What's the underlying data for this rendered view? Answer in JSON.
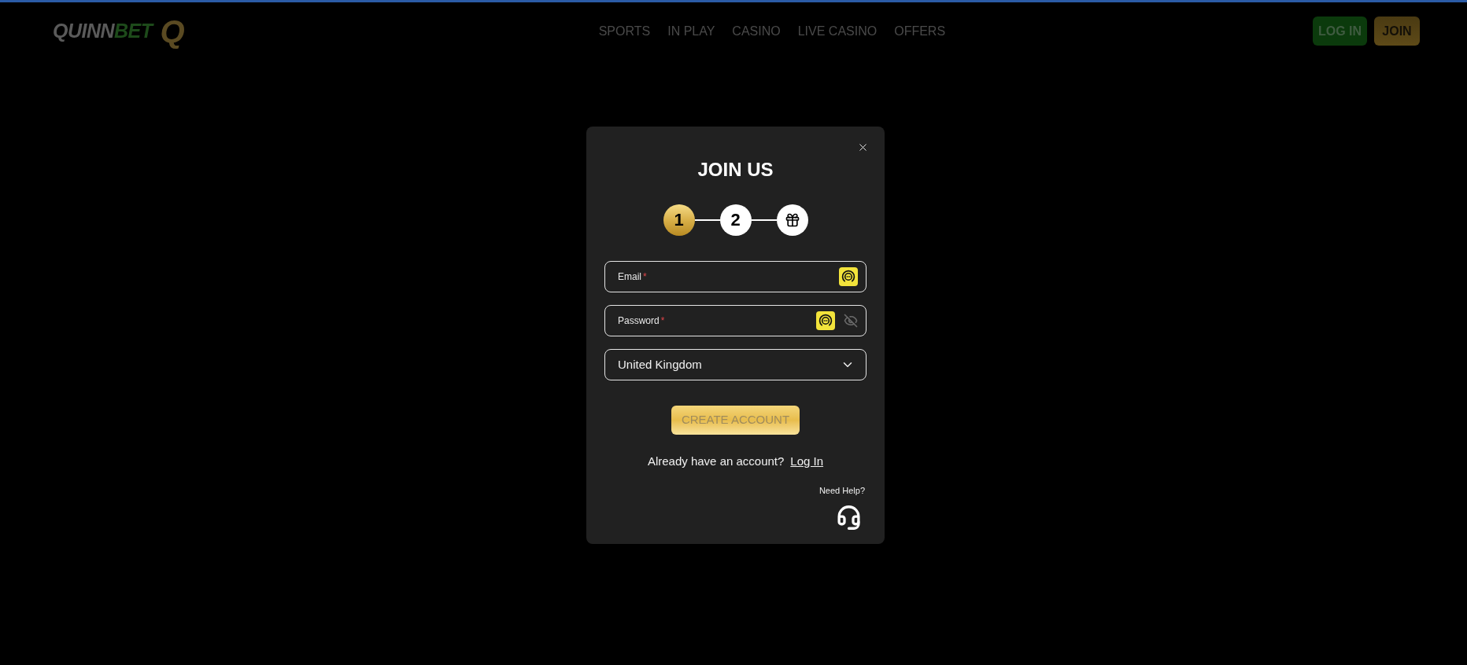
{
  "header": {
    "logo": {
      "name_part_1": "QUINN",
      "name_part_2": "BET",
      "mark": "Q"
    },
    "nav": [
      {
        "label": "SPORTS"
      },
      {
        "label": "IN PLAY"
      },
      {
        "label": "CASINO"
      },
      {
        "label": "LIVE CASINO"
      },
      {
        "label": "OFFERS"
      }
    ],
    "buttons": [
      {
        "kind": "login",
        "label": "LOG IN"
      },
      {
        "kind": "join",
        "label": "JOIN"
      }
    ]
  },
  "modal": {
    "title": "JOIN US",
    "steps": [
      {
        "kind": "number",
        "label": "1",
        "selected": true
      },
      {
        "kind": "number",
        "label": "2",
        "selected": false
      },
      {
        "kind": "gift",
        "selected": false
      }
    ],
    "fields": [
      {
        "kind": "email",
        "label": "Email",
        "required_mark": "*"
      },
      {
        "kind": "password",
        "label": "Password",
        "required_mark": "*"
      }
    ],
    "country_select": {
      "value": "United Kingdom"
    },
    "submit_button": {
      "label": "CREATE ACCOUNT"
    },
    "login_prompt": {
      "text": "Already have an account?",
      "link": "Log In"
    },
    "help": {
      "label": "Need Help?"
    }
  }
}
